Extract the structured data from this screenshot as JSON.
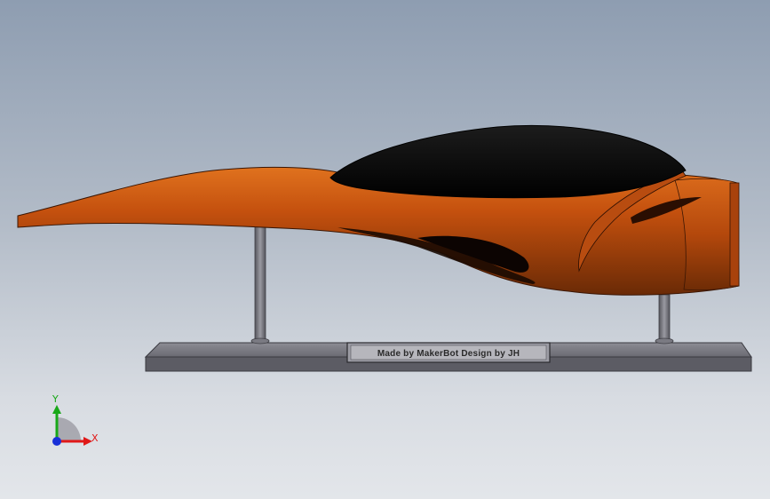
{
  "model": {
    "name": "car-model",
    "body_color": "#c4500e",
    "canopy_color": "#0a0a0a",
    "base_color": "#6e6e76"
  },
  "plaque": {
    "text": "Made by MakerBot Design by JH"
  },
  "triad": {
    "x_label": "X",
    "y_label": "Y",
    "x_color": "#e01818",
    "y_color": "#18a818",
    "z_color": "#1830d8"
  }
}
